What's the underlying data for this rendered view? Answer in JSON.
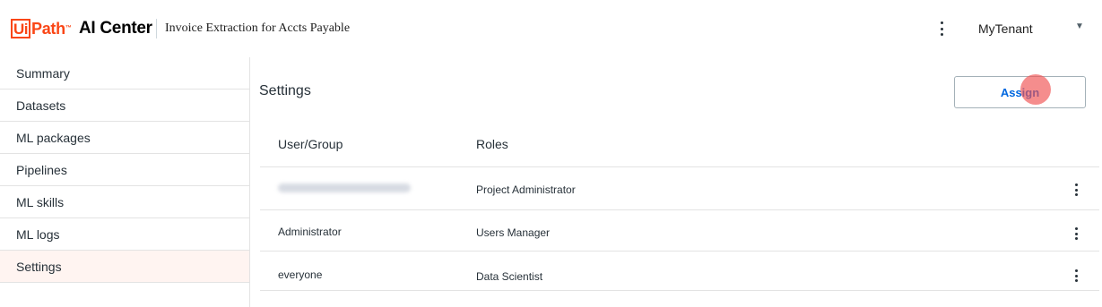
{
  "header": {
    "logo_ui": "Ui",
    "logo_path": "Path",
    "logo_tm": "™",
    "app_name": "AI Center",
    "project_name": "Invoice Extraction for Accts Payable",
    "tenant": "MyTenant",
    "tenant_caret": "▼"
  },
  "sidebar": {
    "items": [
      {
        "label": "Summary"
      },
      {
        "label": "Datasets"
      },
      {
        "label": "ML packages"
      },
      {
        "label": "Pipelines"
      },
      {
        "label": "ML skills"
      },
      {
        "label": "ML logs"
      },
      {
        "label": "Settings",
        "active": true
      }
    ]
  },
  "main": {
    "title": "Settings",
    "assign_label": "Assign",
    "columns": [
      "User/Group",
      "Roles"
    ],
    "rows": [
      {
        "user": "",
        "user_blurred": true,
        "role": "Project Administrator"
      },
      {
        "user": "Administrator",
        "role": "Users Manager"
      },
      {
        "user": "everyone",
        "role": "Data Scientist"
      }
    ]
  },
  "colors": {
    "brand": "#fa4616",
    "link": "#0067df",
    "active_bg": "#fff4f1",
    "border": "#e3e3e3"
  }
}
